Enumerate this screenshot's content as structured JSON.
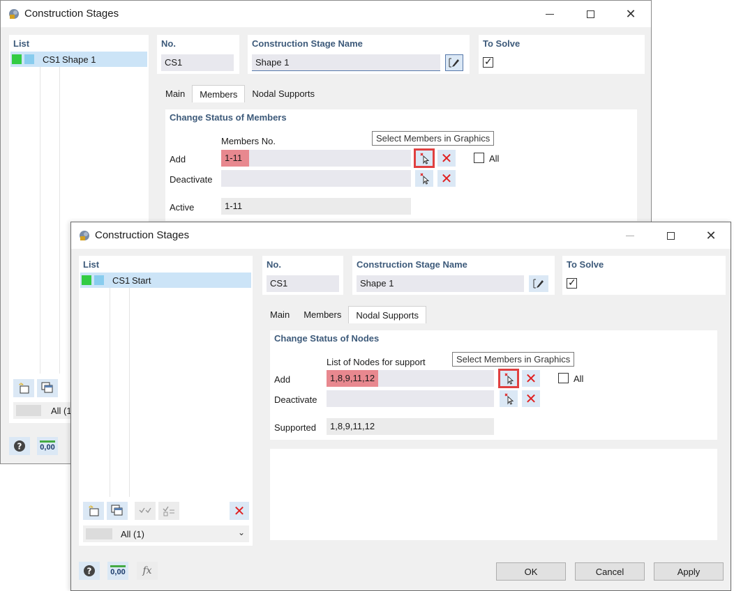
{
  "back_window": {
    "title": "Construction Stages",
    "list_header": "List",
    "list_item": {
      "id": "CS1",
      "name": "Shape 1"
    },
    "list_filter": "All (1)",
    "no_header": "No.",
    "no_value": "CS1",
    "name_header": "Construction Stage Name",
    "name_value": "Shape 1",
    "solve_header": "To Solve",
    "tabs": [
      "Main",
      "Members",
      "Nodal Supports"
    ],
    "section_title": "Change Status of Members",
    "column_label": "Members No.",
    "tooltip": "Select Members in Graphics",
    "add_label": "Add",
    "add_value": "1-11",
    "deactivate_label": "Deactivate",
    "deactivate_value": "",
    "all_label": "All",
    "result_label": "Active",
    "result_value": "1-11"
  },
  "front_window": {
    "title": "Construction Stages",
    "list_header": "List",
    "list_item": {
      "id": "CS1",
      "name": "Start"
    },
    "list_filter": "All (1)",
    "no_header": "No.",
    "no_value": "CS1",
    "name_header": "Construction Stage Name",
    "name_value": "Shape 1",
    "solve_header": "To Solve",
    "tabs": [
      "Main",
      "Members",
      "Nodal Supports"
    ],
    "section_title": "Change Status of Nodes",
    "column_label": "List of Nodes for support",
    "tooltip": "Select Members in Graphics",
    "add_label": "Add",
    "add_value": "1,8,9,11,12",
    "deactivate_label": "Deactivate",
    "deactivate_value": "",
    "all_label": "All",
    "result_label": "Supported",
    "result_value": "1,8,9,11,12",
    "buttons": {
      "ok": "OK",
      "cancel": "Cancel",
      "apply": "Apply"
    },
    "units_icon_text": "0,00",
    "fx_icon_text": "fx"
  },
  "colors": {
    "header_text": "#3d5a7a",
    "selected_row": "#cce4f7",
    "highlight_field": "#e8888f",
    "stage_green": "#33cc44",
    "stage_blue": "#88ccee",
    "delete_red": "#e02020"
  }
}
